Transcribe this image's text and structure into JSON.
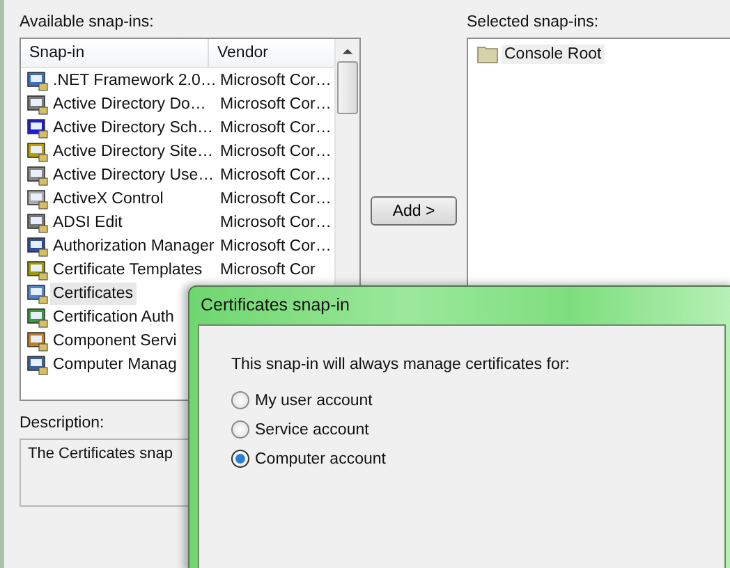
{
  "available": {
    "label": "Available snap-ins:",
    "columns": [
      "Snap-in",
      "Vendor"
    ],
    "rows": [
      {
        "name": ".NET Framework 2.0…",
        "vendor": "Microsoft Cor…",
        "selected": false
      },
      {
        "name": "Active Directory Do…",
        "vendor": "Microsoft Cor…",
        "selected": false
      },
      {
        "name": "Active Directory Sch…",
        "vendor": "Microsoft Cor…",
        "selected": false
      },
      {
        "name": "Active Directory Site…",
        "vendor": "Microsoft Cor…",
        "selected": false
      },
      {
        "name": "Active Directory Use…",
        "vendor": "Microsoft Cor…",
        "selected": false
      },
      {
        "name": "ActiveX Control",
        "vendor": "Microsoft Cor…",
        "selected": false
      },
      {
        "name": "ADSI Edit",
        "vendor": "Microsoft Cor…",
        "selected": false
      },
      {
        "name": "Authorization Manager",
        "vendor": "Microsoft Cor…",
        "selected": false
      },
      {
        "name": "Certificate Templates",
        "vendor": "Microsoft Cor",
        "selected": false
      },
      {
        "name": "Certificates",
        "selected": true
      },
      {
        "name": "Certification Auth",
        "selected": false
      },
      {
        "name": "Component Servi",
        "selected": false
      },
      {
        "name": "Computer Manag",
        "selected": false
      }
    ]
  },
  "add_button": "Add >",
  "selected": {
    "label": "Selected snap-ins:",
    "items": [
      "Console Root"
    ]
  },
  "description": {
    "label": "Description:",
    "text": "The Certificates snap"
  },
  "dialog": {
    "title": "Certificates snap-in",
    "prompt": "This snap-in will always manage certificates for:",
    "options": [
      {
        "label": "My user account",
        "selected": false
      },
      {
        "label": "Service account",
        "selected": false
      },
      {
        "label": "Computer account",
        "selected": true
      }
    ]
  }
}
